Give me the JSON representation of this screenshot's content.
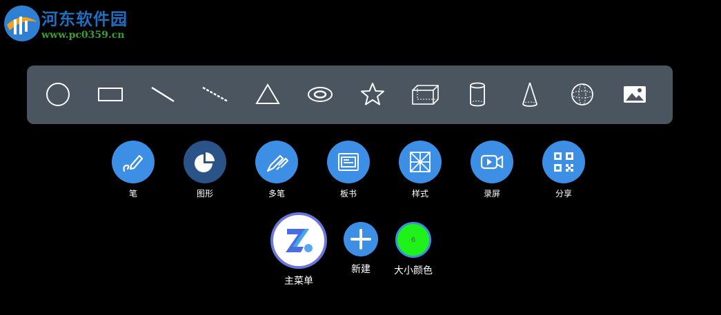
{
  "watermark": {
    "title": "河东软件园",
    "url": "www.pc0359.cn"
  },
  "shape_toolbar": {
    "shapes": [
      {
        "icon": "circle-icon"
      },
      {
        "icon": "rectangle-icon"
      },
      {
        "icon": "line-icon"
      },
      {
        "icon": "dashed-line-icon"
      },
      {
        "icon": "triangle-icon"
      },
      {
        "icon": "ellipse-ring-icon"
      },
      {
        "icon": "star-icon"
      },
      {
        "icon": "cuboid-icon"
      },
      {
        "icon": "cylinder-icon"
      },
      {
        "icon": "cone-icon"
      },
      {
        "icon": "sphere-icon"
      },
      {
        "icon": "image-icon"
      }
    ]
  },
  "tools": {
    "pen": "笔",
    "shape": "图形",
    "multi_pen": "多笔",
    "blackboard": "板书",
    "style": "样式",
    "record": "录屏",
    "share": "分享"
  },
  "bottom": {
    "main_menu": "主菜单",
    "new": "新建",
    "size_color": "大小颜色",
    "size_value": "6",
    "size_color_hex": "#1ff21a"
  },
  "active_tool": "shape"
}
